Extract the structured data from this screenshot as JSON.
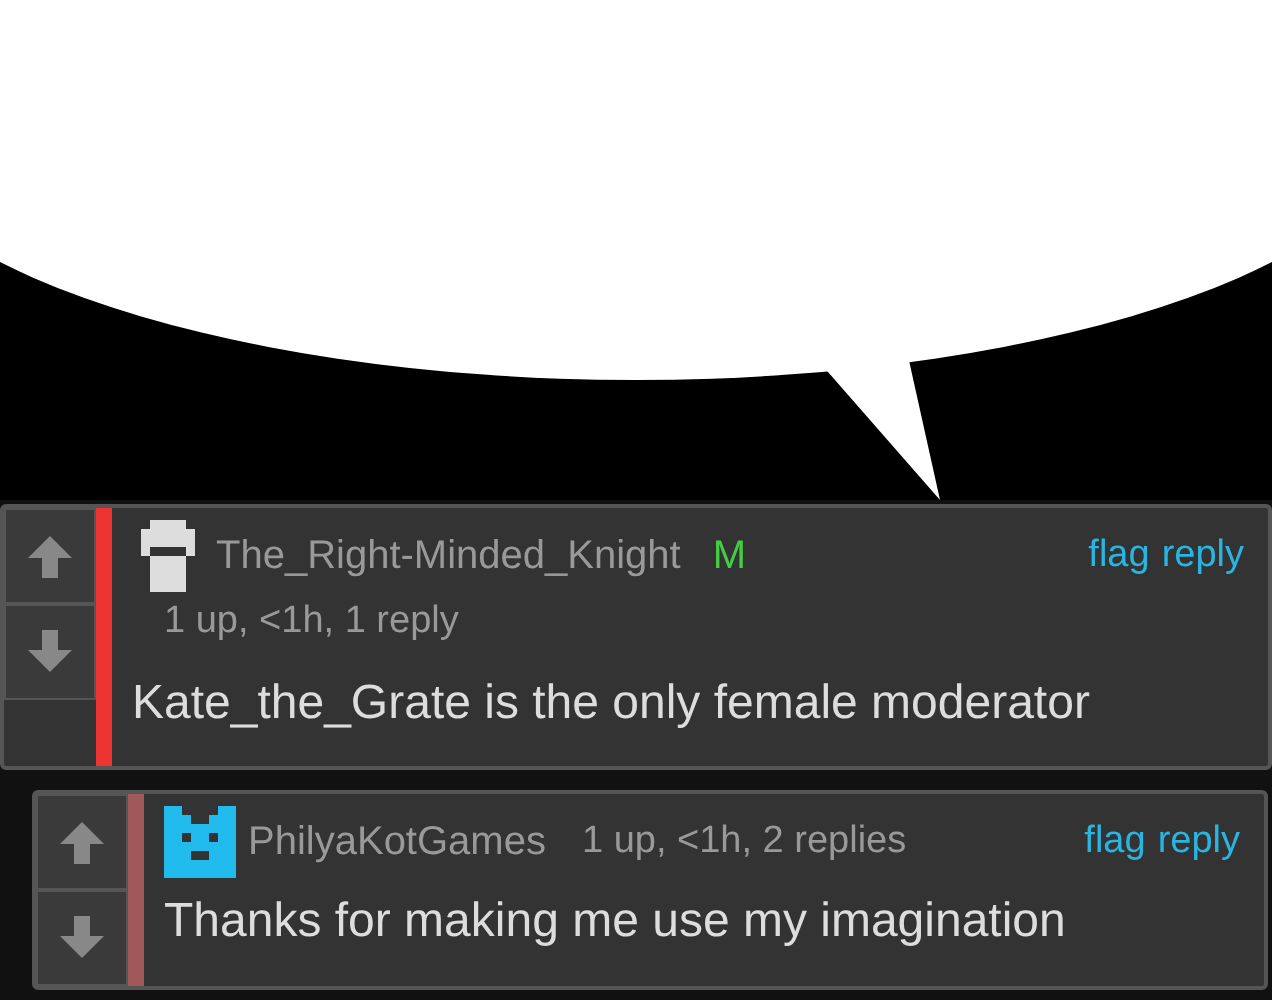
{
  "comments": [
    {
      "kind": "top",
      "author": "The_Right-Minded_Knight",
      "badge": "M",
      "meta": "1 up, <1h, 1 reply",
      "text": "Kate_the_Grate is the only female moderator",
      "color": "#ee3333",
      "actions": [
        "flag",
        "reply"
      ]
    },
    {
      "kind": "reply",
      "author": "PhilyaKotGames",
      "meta": "1 up, <1h, 2 replies",
      "text": "Thanks for making me use my imagination",
      "color": "#a05858",
      "actions": [
        "flag",
        "reply"
      ]
    }
  ]
}
